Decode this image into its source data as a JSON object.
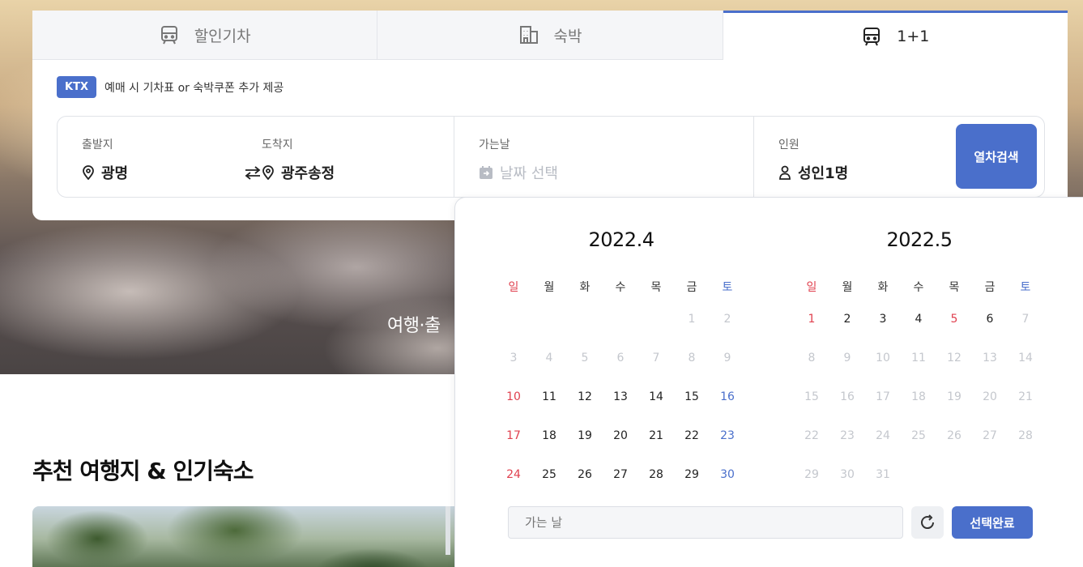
{
  "tabs": [
    {
      "label": "할인기차",
      "icon": "train-icon"
    },
    {
      "label": "숙박",
      "icon": "building-icon"
    },
    {
      "label": "1+1",
      "icon": "train-icon",
      "active": true
    }
  ],
  "promo": {
    "badge": "KTX",
    "text": "예매 시 기차표 or 숙박쿠폰 추가 제공"
  },
  "search": {
    "depart_label": "출발지",
    "depart_value": "광명",
    "arrive_label": "도착지",
    "arrive_value": "광주송정",
    "date_label": "가는날",
    "date_placeholder": "날짜 선택",
    "people_label": "인원",
    "people_value": "성인1명",
    "button_label": "열차검색"
  },
  "hero": {
    "title_visible": "여행·출"
  },
  "section": {
    "title": "추천 여행지 & 인기숙소"
  },
  "calendar": {
    "weekdays": [
      "일",
      "월",
      "화",
      "수",
      "목",
      "금",
      "토"
    ],
    "months": [
      {
        "title": "2022.4",
        "days": [
          {
            "d": ""
          },
          {
            "d": ""
          },
          {
            "d": ""
          },
          {
            "d": ""
          },
          {
            "d": ""
          },
          {
            "d": "1",
            "dis": true
          },
          {
            "d": "2",
            "dis": true
          },
          {
            "d": "3",
            "dis": true
          },
          {
            "d": "4",
            "dis": true
          },
          {
            "d": "5",
            "dis": true
          },
          {
            "d": "6",
            "dis": true
          },
          {
            "d": "7",
            "dis": true
          },
          {
            "d": "8",
            "dis": true
          },
          {
            "d": "9",
            "dis": true
          },
          {
            "d": "10",
            "c": "sun"
          },
          {
            "d": "11"
          },
          {
            "d": "12"
          },
          {
            "d": "13"
          },
          {
            "d": "14"
          },
          {
            "d": "15"
          },
          {
            "d": "16",
            "c": "sat"
          },
          {
            "d": "17",
            "c": "sun"
          },
          {
            "d": "18"
          },
          {
            "d": "19"
          },
          {
            "d": "20"
          },
          {
            "d": "21"
          },
          {
            "d": "22"
          },
          {
            "d": "23",
            "c": "sat"
          },
          {
            "d": "24",
            "c": "sun"
          },
          {
            "d": "25"
          },
          {
            "d": "26"
          },
          {
            "d": "27"
          },
          {
            "d": "28"
          },
          {
            "d": "29"
          },
          {
            "d": "30",
            "c": "sat"
          }
        ]
      },
      {
        "title": "2022.5",
        "days": [
          {
            "d": "1",
            "c": "sun"
          },
          {
            "d": "2"
          },
          {
            "d": "3"
          },
          {
            "d": "4"
          },
          {
            "d": "5",
            "c": "sun"
          },
          {
            "d": "6"
          },
          {
            "d": "7",
            "dis": true
          },
          {
            "d": "8",
            "dis": true
          },
          {
            "d": "9",
            "dis": true
          },
          {
            "d": "10",
            "dis": true
          },
          {
            "d": "11",
            "dis": true
          },
          {
            "d": "12",
            "dis": true
          },
          {
            "d": "13",
            "dis": true
          },
          {
            "d": "14",
            "dis": true
          },
          {
            "d": "15",
            "dis": true
          },
          {
            "d": "16",
            "dis": true
          },
          {
            "d": "17",
            "dis": true
          },
          {
            "d": "18",
            "dis": true
          },
          {
            "d": "19",
            "dis": true
          },
          {
            "d": "20",
            "dis": true
          },
          {
            "d": "21",
            "dis": true
          },
          {
            "d": "22",
            "dis": true
          },
          {
            "d": "23",
            "dis": true
          },
          {
            "d": "24",
            "dis": true
          },
          {
            "d": "25",
            "dis": true
          },
          {
            "d": "26",
            "dis": true
          },
          {
            "d": "27",
            "dis": true
          },
          {
            "d": "28",
            "dis": true
          },
          {
            "d": "29",
            "dis": true
          },
          {
            "d": "30",
            "dis": true
          },
          {
            "d": "31",
            "dis": true
          }
        ]
      }
    ],
    "input_placeholder": "가는 날",
    "done_label": "선택완료"
  },
  "colors": {
    "accent": "#4a6fcb",
    "sunday": "#e0414f",
    "saturday": "#4a6fcb"
  }
}
